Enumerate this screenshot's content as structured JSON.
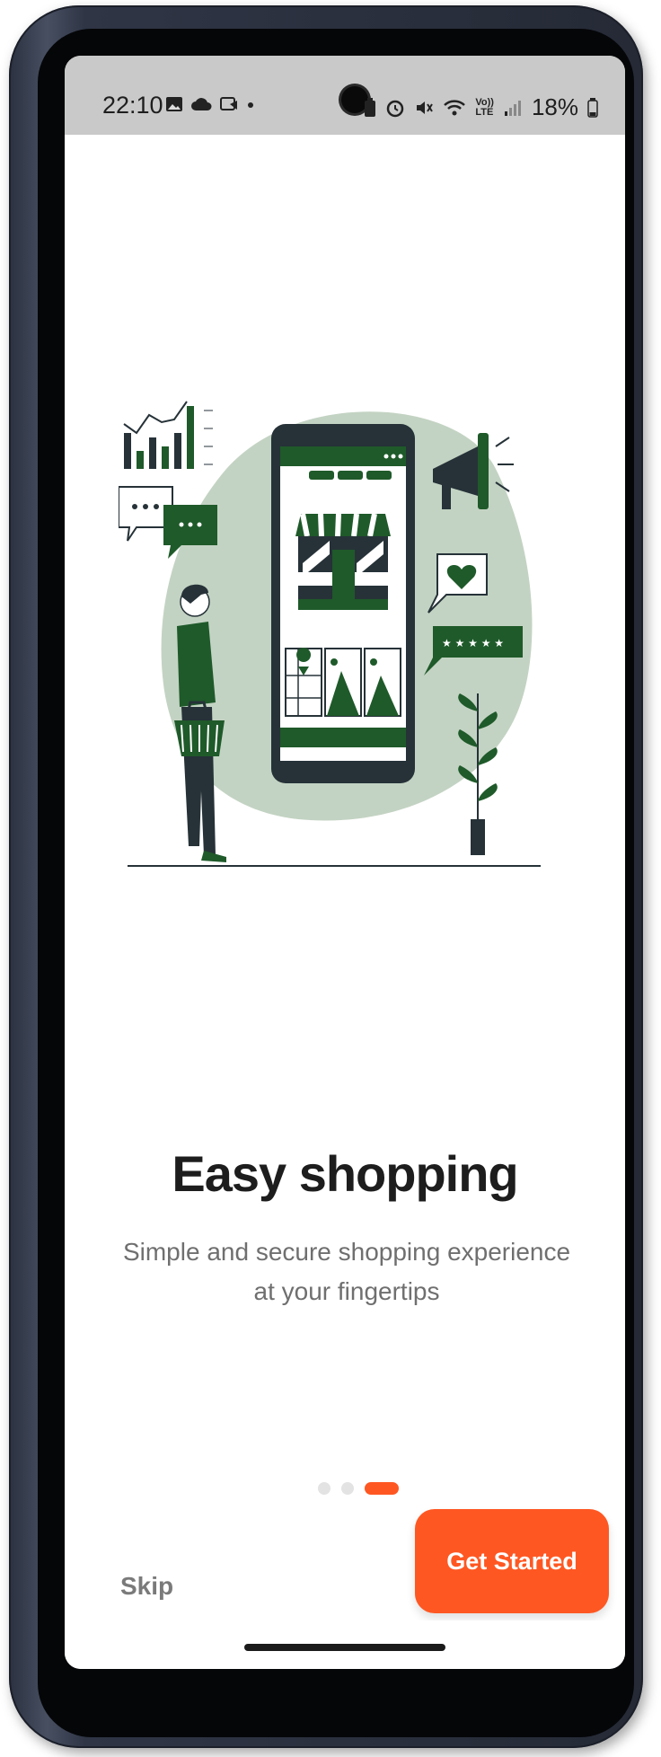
{
  "status_bar": {
    "time": "22:10",
    "left_icons": [
      "gallery-icon",
      "cloud-icon",
      "screen-record-icon",
      "dot-icon"
    ],
    "right_icons": [
      "battery-saver-icon",
      "alarm-icon",
      "mute-icon",
      "wifi-icon",
      "volte-icon",
      "signal-icon"
    ],
    "volte_label_top": "Vo))",
    "volte_label_bottom": "LTE",
    "battery": "18%"
  },
  "onboarding": {
    "illustration": "shopping-illustration",
    "title": "Easy shopping",
    "subtitle": "Simple and secure shopping experience at your fingertips",
    "page_count": 3,
    "current_page": 3
  },
  "actions": {
    "skip_label": "Skip",
    "cta_label": "Get Started"
  },
  "colors": {
    "accent": "#ff5722",
    "illustration_green": "#1f5a2a",
    "illustration_blob": "#c3d3c3",
    "dark": "#263238"
  }
}
